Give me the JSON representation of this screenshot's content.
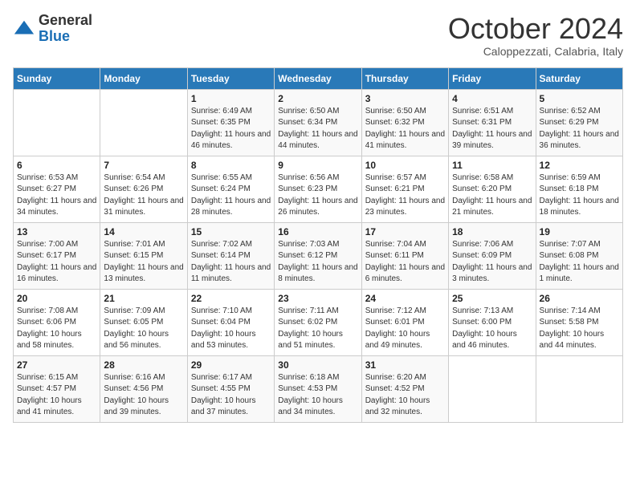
{
  "logo": {
    "general": "General",
    "blue": "Blue"
  },
  "title": "October 2024",
  "subtitle": "Caloppezzati, Calabria, Italy",
  "days_header": [
    "Sunday",
    "Monday",
    "Tuesday",
    "Wednesday",
    "Thursday",
    "Friday",
    "Saturday"
  ],
  "weeks": [
    [
      {
        "day": "",
        "sunrise": "",
        "sunset": "",
        "daylight": ""
      },
      {
        "day": "",
        "sunrise": "",
        "sunset": "",
        "daylight": ""
      },
      {
        "day": "1",
        "sunrise": "Sunrise: 6:49 AM",
        "sunset": "Sunset: 6:35 PM",
        "daylight": "Daylight: 11 hours and 46 minutes."
      },
      {
        "day": "2",
        "sunrise": "Sunrise: 6:50 AM",
        "sunset": "Sunset: 6:34 PM",
        "daylight": "Daylight: 11 hours and 44 minutes."
      },
      {
        "day": "3",
        "sunrise": "Sunrise: 6:50 AM",
        "sunset": "Sunset: 6:32 PM",
        "daylight": "Daylight: 11 hours and 41 minutes."
      },
      {
        "day": "4",
        "sunrise": "Sunrise: 6:51 AM",
        "sunset": "Sunset: 6:31 PM",
        "daylight": "Daylight: 11 hours and 39 minutes."
      },
      {
        "day": "5",
        "sunrise": "Sunrise: 6:52 AM",
        "sunset": "Sunset: 6:29 PM",
        "daylight": "Daylight: 11 hours and 36 minutes."
      }
    ],
    [
      {
        "day": "6",
        "sunrise": "Sunrise: 6:53 AM",
        "sunset": "Sunset: 6:27 PM",
        "daylight": "Daylight: 11 hours and 34 minutes."
      },
      {
        "day": "7",
        "sunrise": "Sunrise: 6:54 AM",
        "sunset": "Sunset: 6:26 PM",
        "daylight": "Daylight: 11 hours and 31 minutes."
      },
      {
        "day": "8",
        "sunrise": "Sunrise: 6:55 AM",
        "sunset": "Sunset: 6:24 PM",
        "daylight": "Daylight: 11 hours and 28 minutes."
      },
      {
        "day": "9",
        "sunrise": "Sunrise: 6:56 AM",
        "sunset": "Sunset: 6:23 PM",
        "daylight": "Daylight: 11 hours and 26 minutes."
      },
      {
        "day": "10",
        "sunrise": "Sunrise: 6:57 AM",
        "sunset": "Sunset: 6:21 PM",
        "daylight": "Daylight: 11 hours and 23 minutes."
      },
      {
        "day": "11",
        "sunrise": "Sunrise: 6:58 AM",
        "sunset": "Sunset: 6:20 PM",
        "daylight": "Daylight: 11 hours and 21 minutes."
      },
      {
        "day": "12",
        "sunrise": "Sunrise: 6:59 AM",
        "sunset": "Sunset: 6:18 PM",
        "daylight": "Daylight: 11 hours and 18 minutes."
      }
    ],
    [
      {
        "day": "13",
        "sunrise": "Sunrise: 7:00 AM",
        "sunset": "Sunset: 6:17 PM",
        "daylight": "Daylight: 11 hours and 16 minutes."
      },
      {
        "day": "14",
        "sunrise": "Sunrise: 7:01 AM",
        "sunset": "Sunset: 6:15 PM",
        "daylight": "Daylight: 11 hours and 13 minutes."
      },
      {
        "day": "15",
        "sunrise": "Sunrise: 7:02 AM",
        "sunset": "Sunset: 6:14 PM",
        "daylight": "Daylight: 11 hours and 11 minutes."
      },
      {
        "day": "16",
        "sunrise": "Sunrise: 7:03 AM",
        "sunset": "Sunset: 6:12 PM",
        "daylight": "Daylight: 11 hours and 8 minutes."
      },
      {
        "day": "17",
        "sunrise": "Sunrise: 7:04 AM",
        "sunset": "Sunset: 6:11 PM",
        "daylight": "Daylight: 11 hours and 6 minutes."
      },
      {
        "day": "18",
        "sunrise": "Sunrise: 7:06 AM",
        "sunset": "Sunset: 6:09 PM",
        "daylight": "Daylight: 11 hours and 3 minutes."
      },
      {
        "day": "19",
        "sunrise": "Sunrise: 7:07 AM",
        "sunset": "Sunset: 6:08 PM",
        "daylight": "Daylight: 11 hours and 1 minute."
      }
    ],
    [
      {
        "day": "20",
        "sunrise": "Sunrise: 7:08 AM",
        "sunset": "Sunset: 6:06 PM",
        "daylight": "Daylight: 10 hours and 58 minutes."
      },
      {
        "day": "21",
        "sunrise": "Sunrise: 7:09 AM",
        "sunset": "Sunset: 6:05 PM",
        "daylight": "Daylight: 10 hours and 56 minutes."
      },
      {
        "day": "22",
        "sunrise": "Sunrise: 7:10 AM",
        "sunset": "Sunset: 6:04 PM",
        "daylight": "Daylight: 10 hours and 53 minutes."
      },
      {
        "day": "23",
        "sunrise": "Sunrise: 7:11 AM",
        "sunset": "Sunset: 6:02 PM",
        "daylight": "Daylight: 10 hours and 51 minutes."
      },
      {
        "day": "24",
        "sunrise": "Sunrise: 7:12 AM",
        "sunset": "Sunset: 6:01 PM",
        "daylight": "Daylight: 10 hours and 49 minutes."
      },
      {
        "day": "25",
        "sunrise": "Sunrise: 7:13 AM",
        "sunset": "Sunset: 6:00 PM",
        "daylight": "Daylight: 10 hours and 46 minutes."
      },
      {
        "day": "26",
        "sunrise": "Sunrise: 7:14 AM",
        "sunset": "Sunset: 5:58 PM",
        "daylight": "Daylight: 10 hours and 44 minutes."
      }
    ],
    [
      {
        "day": "27",
        "sunrise": "Sunrise: 6:15 AM",
        "sunset": "Sunset: 4:57 PM",
        "daylight": "Daylight: 10 hours and 41 minutes."
      },
      {
        "day": "28",
        "sunrise": "Sunrise: 6:16 AM",
        "sunset": "Sunset: 4:56 PM",
        "daylight": "Daylight: 10 hours and 39 minutes."
      },
      {
        "day": "29",
        "sunrise": "Sunrise: 6:17 AM",
        "sunset": "Sunset: 4:55 PM",
        "daylight": "Daylight: 10 hours and 37 minutes."
      },
      {
        "day": "30",
        "sunrise": "Sunrise: 6:18 AM",
        "sunset": "Sunset: 4:53 PM",
        "daylight": "Daylight: 10 hours and 34 minutes."
      },
      {
        "day": "31",
        "sunrise": "Sunrise: 6:20 AM",
        "sunset": "Sunset: 4:52 PM",
        "daylight": "Daylight: 10 hours and 32 minutes."
      },
      {
        "day": "",
        "sunrise": "",
        "sunset": "",
        "daylight": ""
      },
      {
        "day": "",
        "sunrise": "",
        "sunset": "",
        "daylight": ""
      }
    ]
  ]
}
